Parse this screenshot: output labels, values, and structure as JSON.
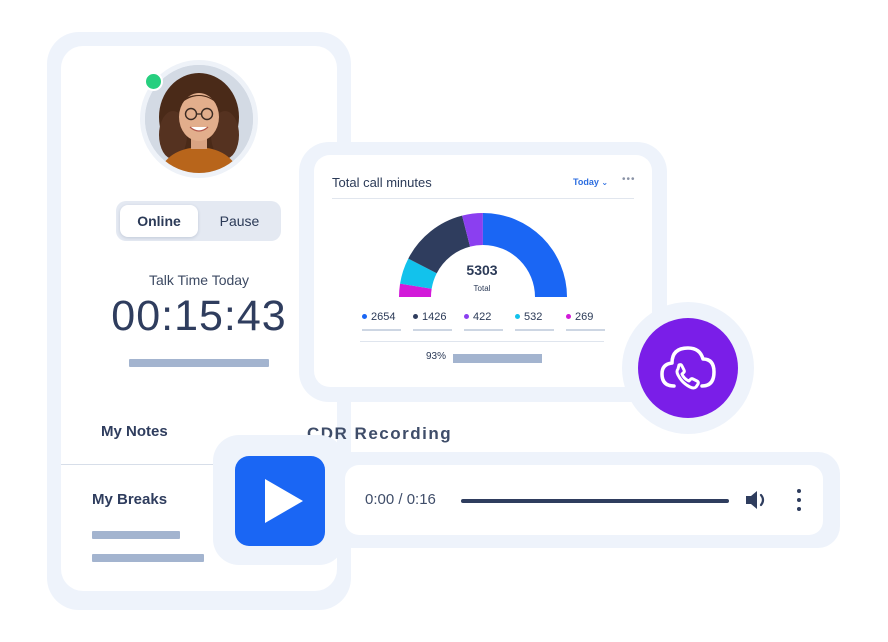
{
  "agent": {
    "status_options": {
      "online": "Online",
      "pause": "Pause"
    },
    "talk_time_label": "Talk Time Today",
    "talk_time_value": "00:15:43",
    "notes_title": "My Notes",
    "breaks_title": "My Breaks"
  },
  "chart": {
    "title": "Total call minutes",
    "period": "Today",
    "total_value": "5303",
    "total_label": "Total",
    "progress_label": "93%"
  },
  "chart_data": {
    "type": "pie",
    "title": "Total call minutes",
    "total": 5303,
    "categories": [
      "2654",
      "1426",
      "422",
      "532",
      "269"
    ],
    "values": [
      2654,
      1426,
      422,
      532,
      269
    ],
    "colors": [
      "#1a66f4",
      "#2f3d5e",
      "#8b3ff0",
      "#12c2ec",
      "#d21ad9"
    ],
    "style": "half-donut gauge",
    "legend_position": "bottom"
  },
  "recording": {
    "title": "CDR Recording",
    "time": "0:00 / 0:16"
  },
  "icons": {
    "play": "play-icon",
    "volume": "volume-icon",
    "menu": "more-vertical-icon",
    "cloud_phone": "cloud-phone-icon"
  },
  "colors": {
    "accent_blue": "#1a66f4",
    "brand_purple": "#7a1ee8",
    "online_green": "#27cf7f"
  }
}
